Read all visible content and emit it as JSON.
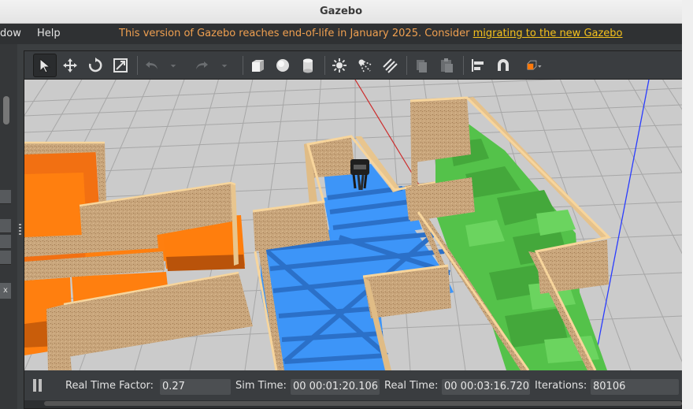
{
  "window": {
    "title": "Gazebo"
  },
  "menubar": {
    "items": [
      "dow",
      "Help"
    ],
    "notice_text": "This version of Gazebo reaches end-of-life in January 2025. Consider ",
    "notice_link": "migrating to the new Gazebo"
  },
  "toolbar": {
    "tools": [
      "select-mode",
      "translate-mode",
      "rotate-mode",
      "scale-mode",
      "undo",
      "undo-history",
      "redo",
      "redo-history",
      "box",
      "sphere",
      "cylinder",
      "point-light",
      "spot-light",
      "directional-light",
      "copy",
      "paste",
      "align",
      "snap",
      "view-angle"
    ],
    "active_tool": "select-mode"
  },
  "scene": {
    "colors": {
      "ground": "#c9c9c9",
      "wall_face": "#c7a57a",
      "wall_top": "#f6d49a",
      "orange": "#ff7a0c",
      "blue": "#3e98ff",
      "green": "#4fc046"
    }
  },
  "statusbar": {
    "real_time_factor_label": "Real Time Factor:",
    "real_time_factor": "0.27",
    "sim_time_label": "Sim Time:",
    "sim_time": "00 00:01:20.106",
    "real_time_label": "Real Time:",
    "real_time": "00 00:03:16.720",
    "iterations_label": "Iterations:",
    "iterations": "80106"
  }
}
